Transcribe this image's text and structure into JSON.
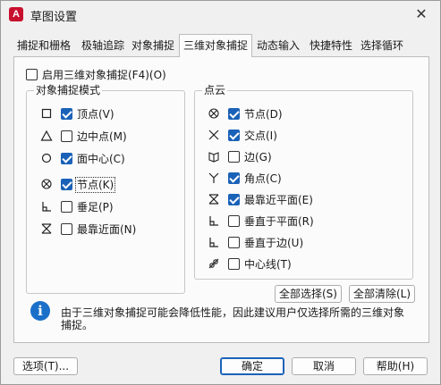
{
  "window": {
    "app_icon_letter": "A",
    "title": "草图设置",
    "close_symbol": "✕"
  },
  "tabs": [
    {
      "label": "捕捉和栅格"
    },
    {
      "label": "极轴追踪"
    },
    {
      "label": "对象捕捉"
    },
    {
      "label": "三维对象捕捉",
      "active": true
    },
    {
      "label": "动态输入"
    },
    {
      "label": "快捷特性"
    },
    {
      "label": "选择循环"
    }
  ],
  "enable": {
    "label": "启用三维对象捕捉(F4)(O)",
    "checked": false
  },
  "object_modes": {
    "title": "对象捕捉模式",
    "items": [
      {
        "label": "顶点(V)",
        "checked": true,
        "icon": "square-icon"
      },
      {
        "label": "边中点(M)",
        "checked": false,
        "icon": "triangle-icon"
      },
      {
        "label": "面中心(C)",
        "checked": true,
        "icon": "circle-icon"
      },
      {
        "label": "节点(K)",
        "checked": true,
        "icon": "node-icon",
        "focused": true
      },
      {
        "label": "垂足(P)",
        "checked": false,
        "icon": "perpendicular-icon"
      },
      {
        "label": "最靠近面(N)",
        "checked": false,
        "icon": "hourglass-icon"
      }
    ]
  },
  "point_cloud": {
    "title": "点云",
    "items": [
      {
        "label": "节点(D)",
        "checked": true,
        "icon": "node-icon"
      },
      {
        "label": "交点(I)",
        "checked": true,
        "icon": "intersection-icon"
      },
      {
        "label": "边(G)",
        "checked": false,
        "icon": "edge-icon"
      },
      {
        "label": "角点(C)",
        "checked": true,
        "icon": "corner-icon"
      },
      {
        "label": "最靠近平面(E)",
        "checked": true,
        "icon": "hourglass-icon"
      },
      {
        "label": "垂直于平面(R)",
        "checked": false,
        "icon": "perpendicular-icon"
      },
      {
        "label": "垂直于边(U)",
        "checked": false,
        "icon": "perpendicular-icon"
      },
      {
        "label": "中心线(T)",
        "checked": false,
        "icon": "centerline-icon"
      }
    ]
  },
  "buttons": {
    "select_all": "全部选择(S)",
    "clear_all": "全部清除(L)",
    "options": "选项(T)...",
    "ok": "确定",
    "cancel": "取消",
    "help": "帮助(H)"
  },
  "info": {
    "icon_letter": "i",
    "text": "由于三维对象捕捉可能会降低性能，因此建议用户仅选择所需的三维对象捕捉。"
  }
}
